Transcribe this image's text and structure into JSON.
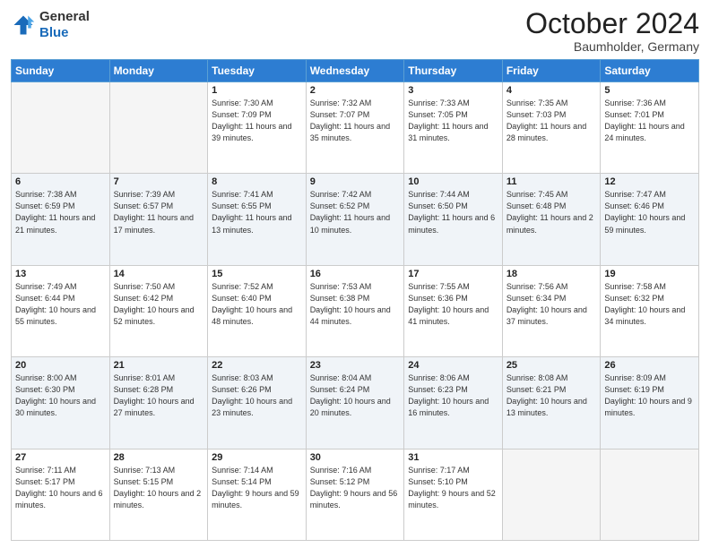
{
  "header": {
    "logo_general": "General",
    "logo_blue": "Blue",
    "month": "October 2024",
    "location": "Baumholder, Germany"
  },
  "days_of_week": [
    "Sunday",
    "Monday",
    "Tuesday",
    "Wednesday",
    "Thursday",
    "Friday",
    "Saturday"
  ],
  "weeks": [
    [
      {
        "day": "",
        "info": ""
      },
      {
        "day": "",
        "info": ""
      },
      {
        "day": "1",
        "info": "Sunrise: 7:30 AM\nSunset: 7:09 PM\nDaylight: 11 hours and 39 minutes."
      },
      {
        "day": "2",
        "info": "Sunrise: 7:32 AM\nSunset: 7:07 PM\nDaylight: 11 hours and 35 minutes."
      },
      {
        "day": "3",
        "info": "Sunrise: 7:33 AM\nSunset: 7:05 PM\nDaylight: 11 hours and 31 minutes."
      },
      {
        "day": "4",
        "info": "Sunrise: 7:35 AM\nSunset: 7:03 PM\nDaylight: 11 hours and 28 minutes."
      },
      {
        "day": "5",
        "info": "Sunrise: 7:36 AM\nSunset: 7:01 PM\nDaylight: 11 hours and 24 minutes."
      }
    ],
    [
      {
        "day": "6",
        "info": "Sunrise: 7:38 AM\nSunset: 6:59 PM\nDaylight: 11 hours and 21 minutes."
      },
      {
        "day": "7",
        "info": "Sunrise: 7:39 AM\nSunset: 6:57 PM\nDaylight: 11 hours and 17 minutes."
      },
      {
        "day": "8",
        "info": "Sunrise: 7:41 AM\nSunset: 6:55 PM\nDaylight: 11 hours and 13 minutes."
      },
      {
        "day": "9",
        "info": "Sunrise: 7:42 AM\nSunset: 6:52 PM\nDaylight: 11 hours and 10 minutes."
      },
      {
        "day": "10",
        "info": "Sunrise: 7:44 AM\nSunset: 6:50 PM\nDaylight: 11 hours and 6 minutes."
      },
      {
        "day": "11",
        "info": "Sunrise: 7:45 AM\nSunset: 6:48 PM\nDaylight: 11 hours and 2 minutes."
      },
      {
        "day": "12",
        "info": "Sunrise: 7:47 AM\nSunset: 6:46 PM\nDaylight: 10 hours and 59 minutes."
      }
    ],
    [
      {
        "day": "13",
        "info": "Sunrise: 7:49 AM\nSunset: 6:44 PM\nDaylight: 10 hours and 55 minutes."
      },
      {
        "day": "14",
        "info": "Sunrise: 7:50 AM\nSunset: 6:42 PM\nDaylight: 10 hours and 52 minutes."
      },
      {
        "day": "15",
        "info": "Sunrise: 7:52 AM\nSunset: 6:40 PM\nDaylight: 10 hours and 48 minutes."
      },
      {
        "day": "16",
        "info": "Sunrise: 7:53 AM\nSunset: 6:38 PM\nDaylight: 10 hours and 44 minutes."
      },
      {
        "day": "17",
        "info": "Sunrise: 7:55 AM\nSunset: 6:36 PM\nDaylight: 10 hours and 41 minutes."
      },
      {
        "day": "18",
        "info": "Sunrise: 7:56 AM\nSunset: 6:34 PM\nDaylight: 10 hours and 37 minutes."
      },
      {
        "day": "19",
        "info": "Sunrise: 7:58 AM\nSunset: 6:32 PM\nDaylight: 10 hours and 34 minutes."
      }
    ],
    [
      {
        "day": "20",
        "info": "Sunrise: 8:00 AM\nSunset: 6:30 PM\nDaylight: 10 hours and 30 minutes."
      },
      {
        "day": "21",
        "info": "Sunrise: 8:01 AM\nSunset: 6:28 PM\nDaylight: 10 hours and 27 minutes."
      },
      {
        "day": "22",
        "info": "Sunrise: 8:03 AM\nSunset: 6:26 PM\nDaylight: 10 hours and 23 minutes."
      },
      {
        "day": "23",
        "info": "Sunrise: 8:04 AM\nSunset: 6:24 PM\nDaylight: 10 hours and 20 minutes."
      },
      {
        "day": "24",
        "info": "Sunrise: 8:06 AM\nSunset: 6:23 PM\nDaylight: 10 hours and 16 minutes."
      },
      {
        "day": "25",
        "info": "Sunrise: 8:08 AM\nSunset: 6:21 PM\nDaylight: 10 hours and 13 minutes."
      },
      {
        "day": "26",
        "info": "Sunrise: 8:09 AM\nSunset: 6:19 PM\nDaylight: 10 hours and 9 minutes."
      }
    ],
    [
      {
        "day": "27",
        "info": "Sunrise: 7:11 AM\nSunset: 5:17 PM\nDaylight: 10 hours and 6 minutes."
      },
      {
        "day": "28",
        "info": "Sunrise: 7:13 AM\nSunset: 5:15 PM\nDaylight: 10 hours and 2 minutes."
      },
      {
        "day": "29",
        "info": "Sunrise: 7:14 AM\nSunset: 5:14 PM\nDaylight: 9 hours and 59 minutes."
      },
      {
        "day": "30",
        "info": "Sunrise: 7:16 AM\nSunset: 5:12 PM\nDaylight: 9 hours and 56 minutes."
      },
      {
        "day": "31",
        "info": "Sunrise: 7:17 AM\nSunset: 5:10 PM\nDaylight: 9 hours and 52 minutes."
      },
      {
        "day": "",
        "info": ""
      },
      {
        "day": "",
        "info": ""
      }
    ]
  ]
}
